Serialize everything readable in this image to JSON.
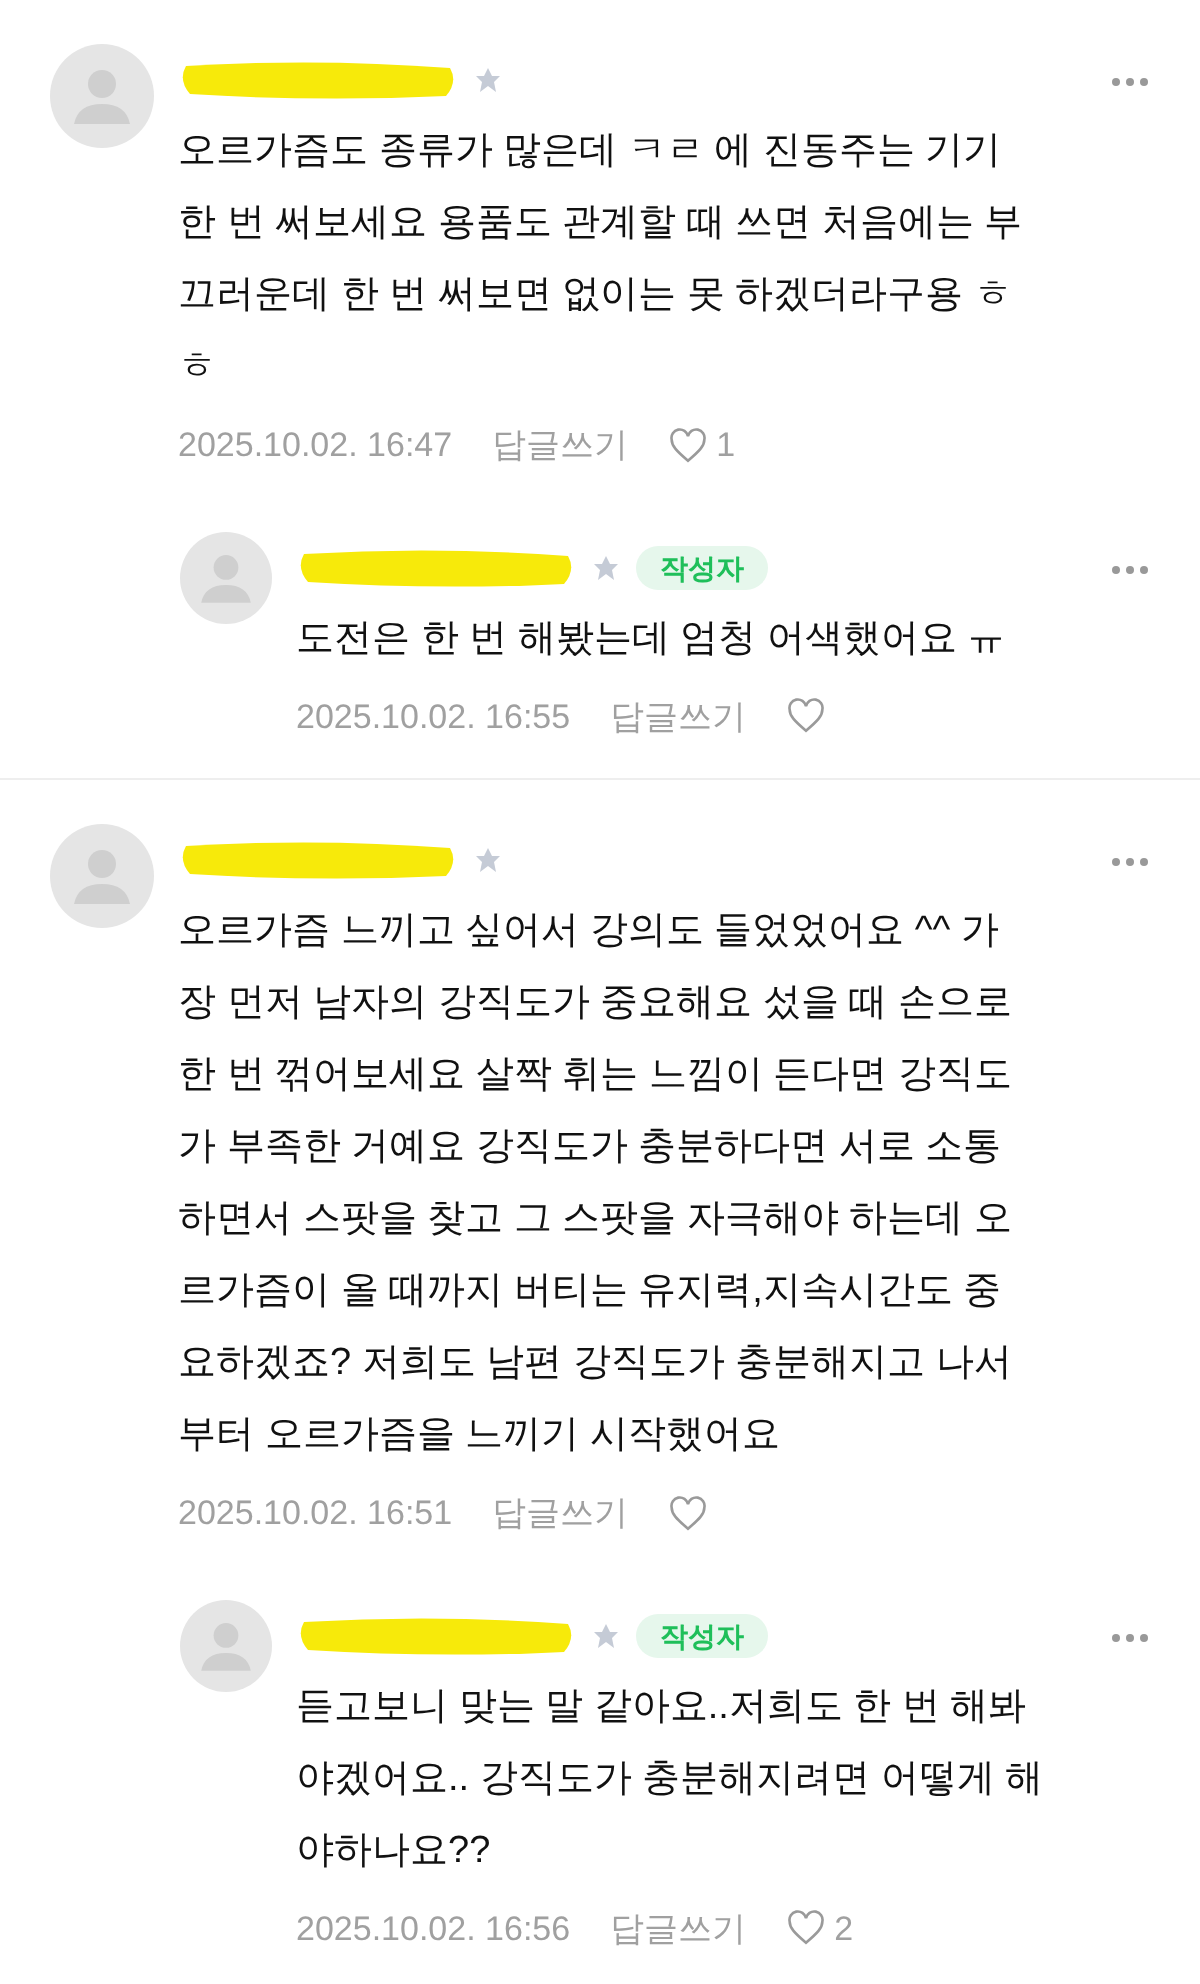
{
  "comments": [
    {
      "lines": [
        "오르가즘도 종류가 많은데 ㅋㄹ 에 진동주는 기기",
        "한 번 써보세요 용품도 관계할 때 쓰면 처음에는 부",
        "끄러운데 한 번 써보면 없이는 못 하겠더라구용 ㅎ",
        "ㅎ"
      ],
      "date": "2025.10.02. 16:47",
      "reply_label": "답글쓰기",
      "likes": "1",
      "children": [
        {
          "badge": "작성자",
          "lines": [
            "도전은 한 번 해봤는데 엄청 어색했어요 ㅠ"
          ],
          "date": "2025.10.02. 16:55",
          "reply_label": "답글쓰기"
        }
      ]
    },
    {
      "lines": [
        "오르가즘 느끼고 싶어서 강의도 들었었어요 ^^ 가",
        "장 먼저 남자의 강직도가 중요해요 섰을 때 손으로",
        "한 번 꺾어보세요 살짝 휘는 느낌이 든다면 강직도",
        "가 부족한 거예요 강직도가 충분하다면 서로 소통",
        "하면서 스팟을 찾고 그 스팟을 자극해야 하는데 오",
        "르가즘이 올 때까지 버티는 유지력,지속시간도 중",
        "요하겠죠? 저희도 남편 강직도가 충분해지고 나서",
        "부터 오르가즘을 느끼기 시작했어요"
      ],
      "date": "2025.10.02. 16:51",
      "reply_label": "답글쓰기",
      "children": [
        {
          "badge": "작성자",
          "lines": [
            "듣고보니 맞는 말 같아요..저희도 한 번 해봐",
            "야겠어요.. 강직도가 충분해지려면 어떻게 해",
            "야하나요??"
          ],
          "date": "2025.10.02. 16:56",
          "reply_label": "답글쓰기",
          "likes": "2"
        }
      ]
    }
  ]
}
